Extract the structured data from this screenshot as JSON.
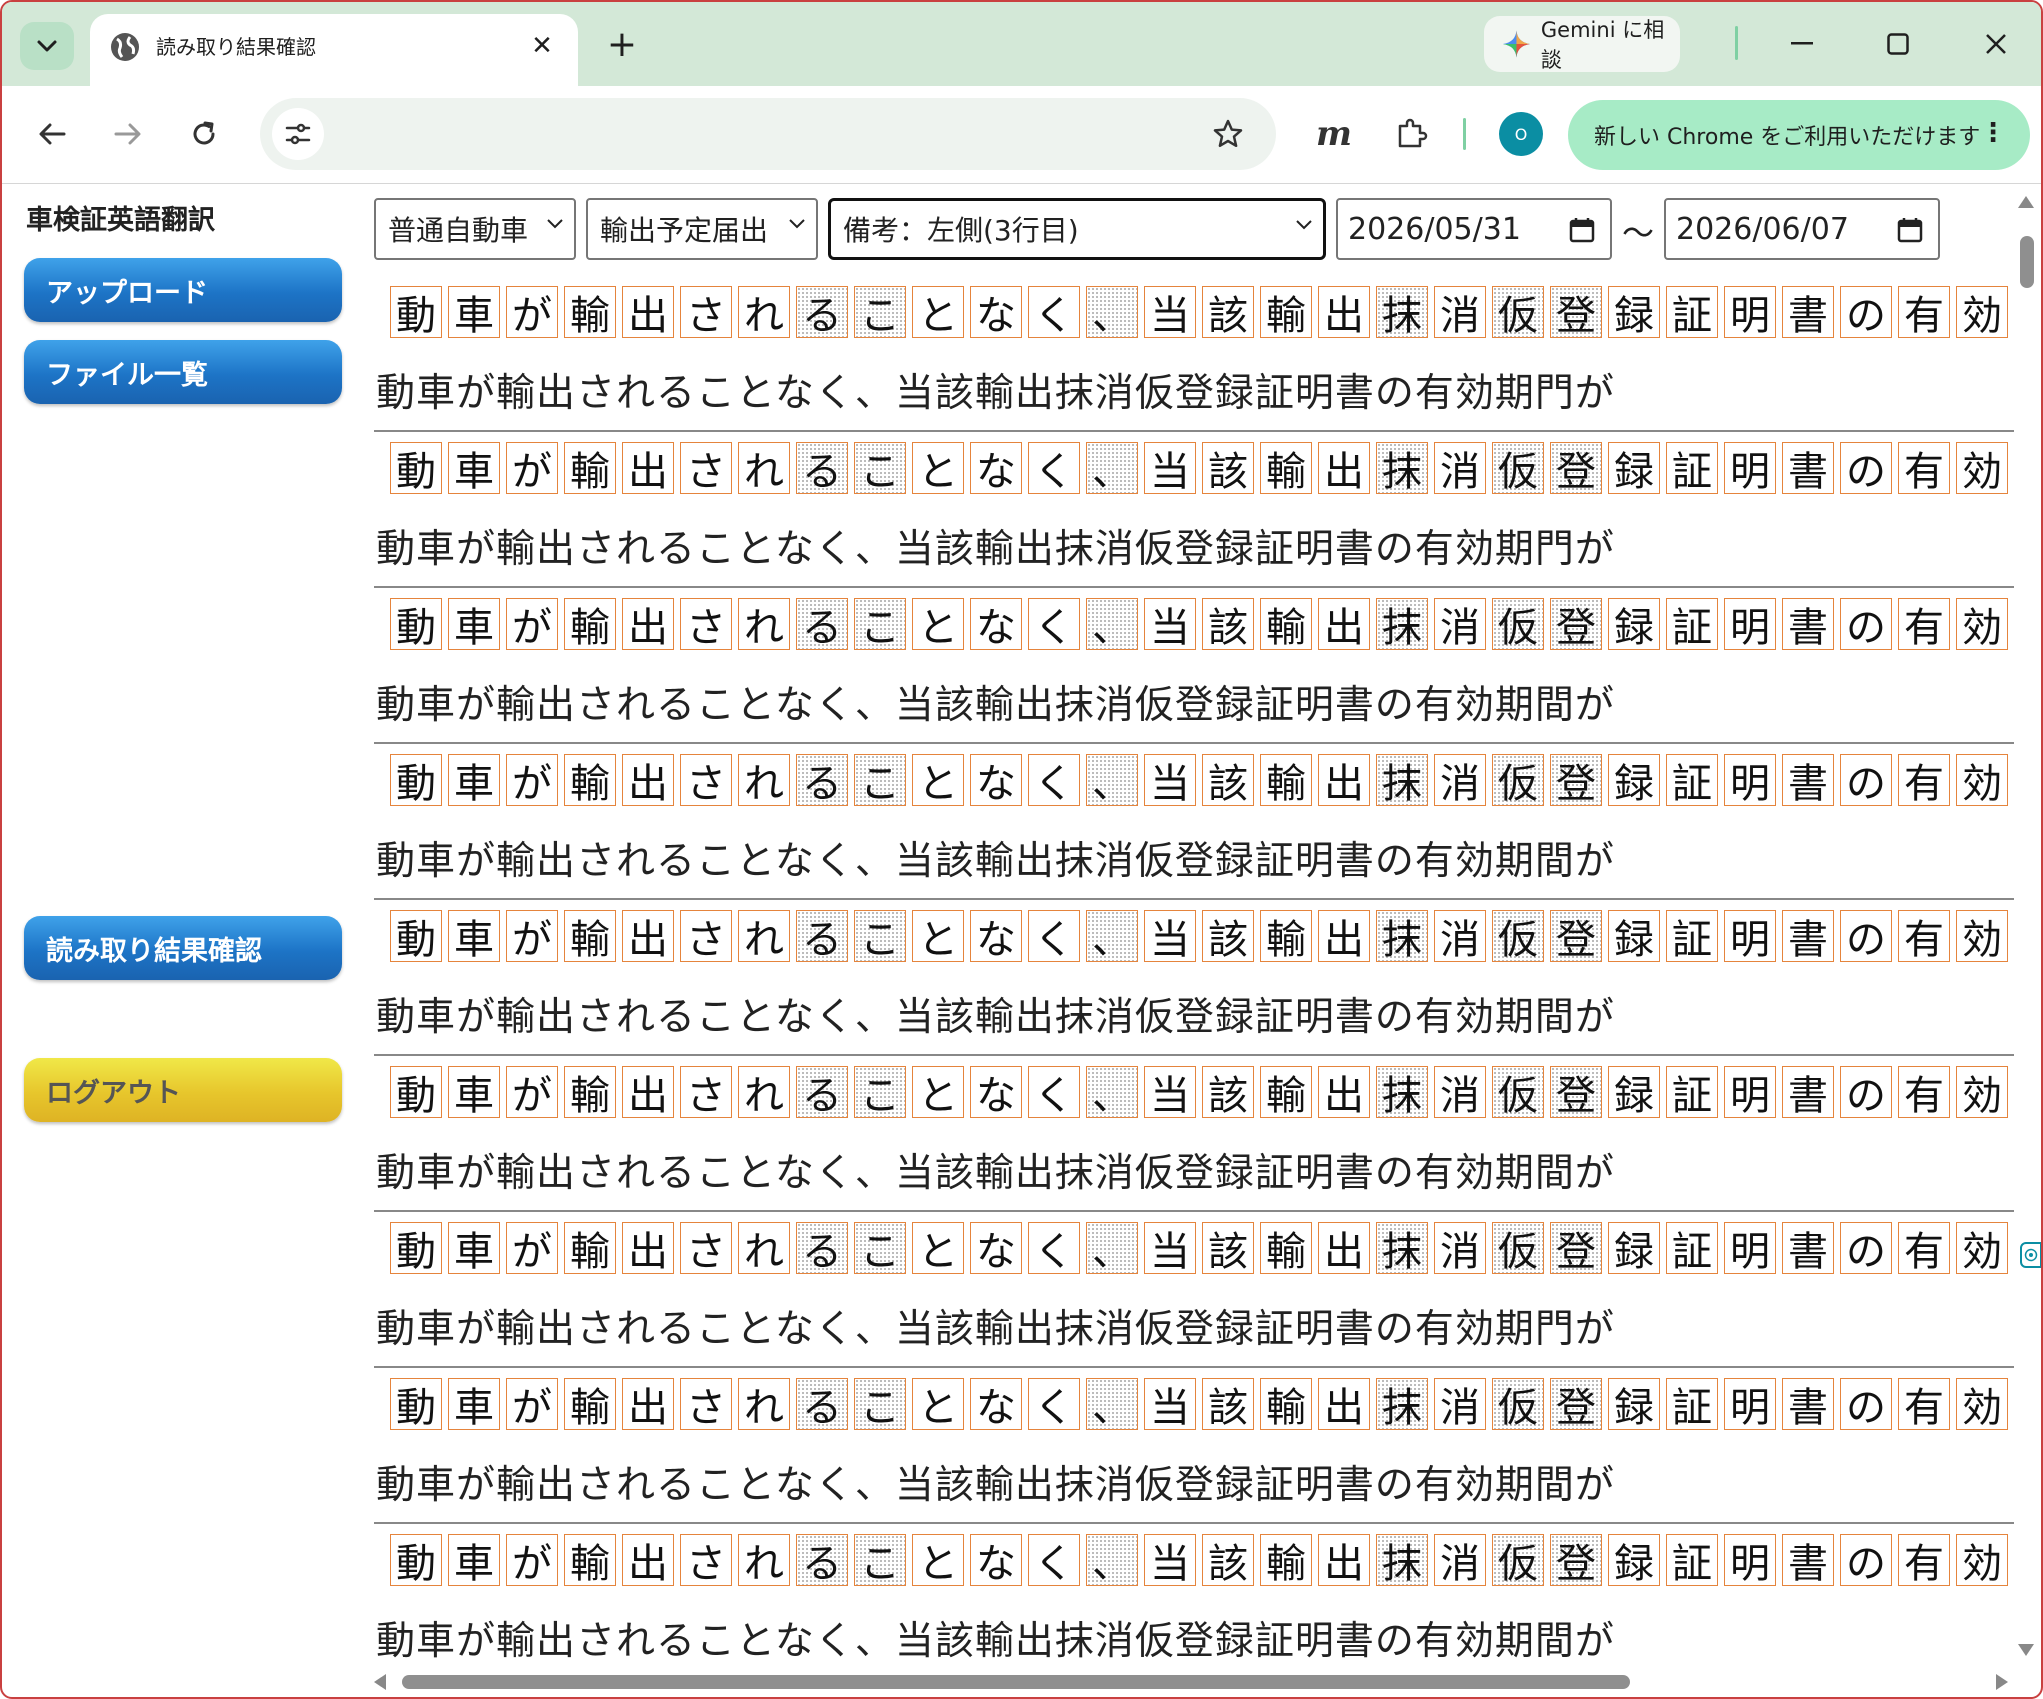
{
  "browser": {
    "tab_title": "読み取り結果確認",
    "tab_close": "✕",
    "new_tab": "+",
    "gemini_label": "Gemini に相談",
    "avatar_initial": "O",
    "update_label": "新しい Chrome をご利用いただけます",
    "extension_m": "m",
    "update_menu": "⋮"
  },
  "app": {
    "title": "車検証英語翻訳"
  },
  "sidebar": {
    "upload": "アップロード",
    "file_list": "ファイル一覧",
    "results": "読み取り結果確認",
    "logout": "ログアウト"
  },
  "filters": {
    "vehicle_type": "普通自動車",
    "document_type": "輸出予定届出",
    "field": "備考：左側(3行目)",
    "date_from": "2026/05/31",
    "date_sep": "〜",
    "date_to": "2026/06/07"
  },
  "results": {
    "image_glyphs": [
      "動",
      "車",
      "が",
      "輸",
      "出",
      "さ",
      "れ",
      "る",
      "こ",
      "と",
      "な",
      "く",
      "、",
      "当",
      "該",
      "輸",
      "出",
      "抹",
      "消",
      "仮",
      "登",
      "録",
      "証",
      "明",
      "書",
      "の",
      "有",
      "効"
    ],
    "noisy_indices": [
      7,
      8,
      12,
      17,
      19,
      20
    ],
    "rows": [
      {
        "ocr": "動車が輸出されることなく、当該輸出抹消仮登録証明書の有効期門が"
      },
      {
        "ocr": "動車が輸出されることなく、当該輸出抹消仮登録証明書の有効期門が"
      },
      {
        "ocr": "動車が輸出されることなく、当該輸出抹消仮登録証明書の有効期間が"
      },
      {
        "ocr": "動車が輸出されることなく、当該輸出抹消仮登録証明書の有効期間が"
      },
      {
        "ocr": "動車が輸出されることなく、当該輸出抹消仮登録証明書の有効期間が"
      },
      {
        "ocr": "動車が輸出されることなく、当該輸出抹消仮登録証明書の有効期間が"
      },
      {
        "ocr": "動車が輸出されることなく、当該輸出抹消仮登録証明書の有効期門が"
      },
      {
        "ocr": "動車が輸出されることなく、当該輸出抹消仮登録証明書の有効期間が"
      },
      {
        "ocr": "動車が輸出されることなく、当該輸出抹消仮登録証明書の有効期間が"
      }
    ]
  },
  "colors": {
    "tabbar": "#d3e8d7",
    "button_blue": "#1d74c6",
    "button_yellow": "#e7c62c",
    "char_box": "#e5843c"
  }
}
